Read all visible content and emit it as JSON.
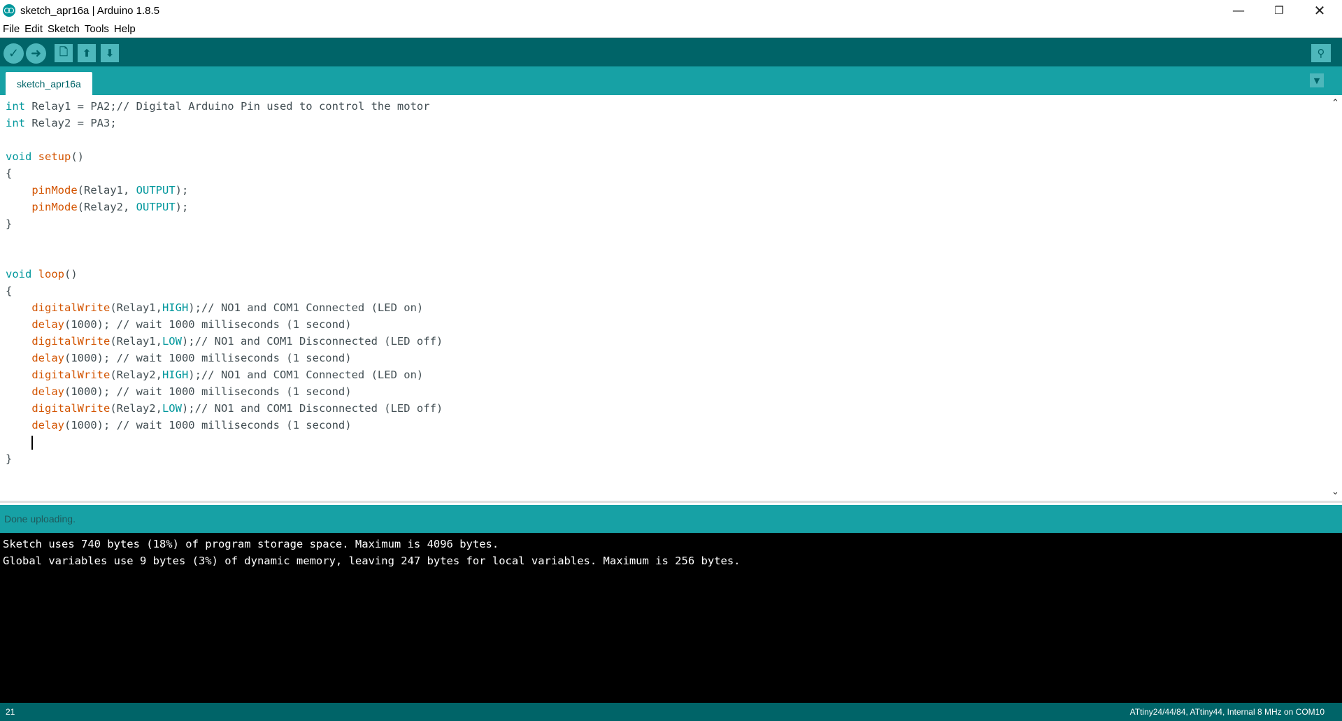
{
  "window": {
    "title": "sketch_apr16a | Arduino 1.8.5",
    "minimize_glyph": "—",
    "restore_glyph": "❐",
    "close_glyph": "✕"
  },
  "menu": {
    "items": [
      "File",
      "Edit",
      "Sketch",
      "Tools",
      "Help"
    ]
  },
  "toolbar": {
    "verify_glyph": "✓",
    "upload_glyph": "➜",
    "new_glyph": "🗋",
    "open_glyph": "⬆",
    "save_glyph": "⬇",
    "serial_monitor_glyph": "⚲"
  },
  "tabs": {
    "active_label": "sketch_apr16a",
    "menu_glyph": "▼"
  },
  "editor": {
    "lines": [
      "int Relay1 = PA2;// Digital Arduino Pin used to control the motor",
      "int Relay2 = PA3;",
      "",
      "void setup()",
      "{",
      "    pinMode(Relay1, OUTPUT);",
      "    pinMode(Relay2, OUTPUT);",
      "}",
      "",
      "",
      "void loop()",
      "{",
      "    digitalWrite(Relay1,HIGH);// NO1 and COM1 Connected (LED on)",
      "    delay(1000); // wait 1000 milliseconds (1 second)",
      "    digitalWrite(Relay1,LOW);// NO1 and COM1 Disconnected (LED off)",
      "    delay(1000); // wait 1000 milliseconds (1 second)",
      "    digitalWrite(Relay2,HIGH);// NO1 and COM1 Connected (LED on)",
      "    delay(1000); // wait 1000 milliseconds (1 second)",
      "    digitalWrite(Relay2,LOW);// NO1 and COM1 Disconnected (LED off)",
      "    delay(1000); // wait 1000 milliseconds (1 second)",
      "    ",
      "}"
    ],
    "cursor_line": 21,
    "scroll_up_glyph": "⌃",
    "scroll_down_glyph": "⌄"
  },
  "status": {
    "message": "Done uploading."
  },
  "console": {
    "lines": [
      "Sketch uses 740 bytes (18%) of program storage space. Maximum is 4096 bytes.",
      "Global variables use 9 bytes (3%) of dynamic memory, leaving 247 bytes for local variables. Maximum is 256 bytes."
    ]
  },
  "footer": {
    "line_number": "21",
    "board_info": "ATtiny24/44/84, ATtiny44, Internal 8 MHz on COM10"
  },
  "colors": {
    "toolbar_bg": "#006468",
    "tabbar_bg": "#17a1a5",
    "keyword_type": "#00979c",
    "keyword_function": "#d35400",
    "console_bg": "#000000"
  }
}
